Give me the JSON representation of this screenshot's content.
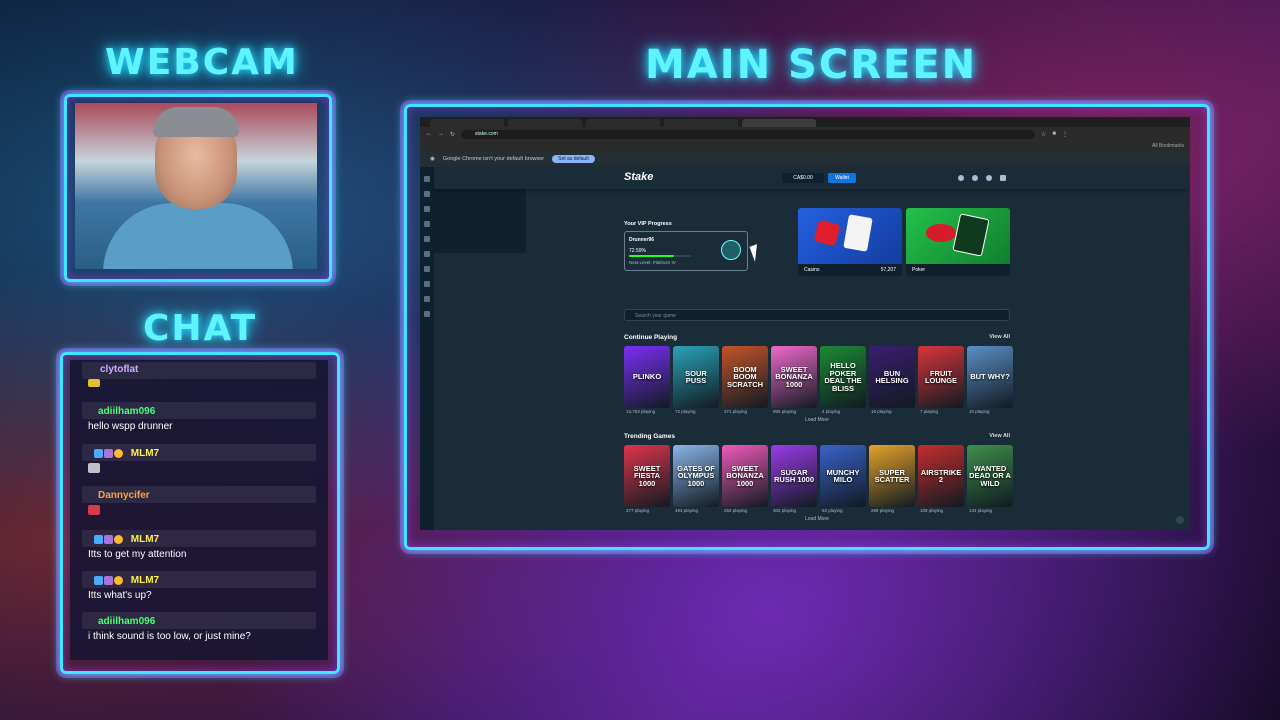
{
  "overlay": {
    "webcam_title": "WEBCAM",
    "main_title": "MAIN SCREEN",
    "chat_title": "CHAT"
  },
  "chat": {
    "messages": [
      {
        "user": "clytoflat",
        "text": "",
        "color": "#c6a7ff"
      },
      {
        "user": "adiilham096",
        "text": "hello wspp drunner",
        "color": "#39ff6a"
      },
      {
        "user": "MLM7",
        "text": "",
        "color": "#fff03a"
      },
      {
        "user": "Dannycifer",
        "text": "",
        "color": "#ff9a2b"
      },
      {
        "user": "MLM7",
        "text": "Itts to get my attention",
        "color": "#fff03a"
      },
      {
        "user": "MLM7",
        "text": "Itts what's up?",
        "color": "#fff03a"
      },
      {
        "user": "adiilham096",
        "text": "i think sound is too low, or just mine?",
        "color": "#39ff6a"
      }
    ]
  },
  "browser": {
    "url": "stake.com",
    "bookmarks_label": "All Bookmarks",
    "default_browser_notice": "Google Chrome isn't your default browser",
    "set_default_label": "Set as default"
  },
  "stake": {
    "logo": "Stake",
    "balance": "CA$0.00",
    "wallet_label": "Wallet",
    "vip": {
      "title": "Your VIP Progress",
      "user": "Drunner96",
      "progress_text": "72.59%",
      "progress_fraction": 0.7259,
      "next_level": "Next Level: Platinum IV"
    },
    "promos": [
      {
        "label": "Casino",
        "count": "57,207",
        "color": "#1e5fd6"
      },
      {
        "label": "Poker",
        "count": "",
        "color": "#1ea040"
      }
    ],
    "search_placeholder": "Search your game",
    "continue_title": "Continue Playing",
    "trending_title": "Trending Games",
    "view_all": "View All",
    "load_more": "Load More",
    "continue_games": [
      {
        "name": "PLINKO",
        "playing": "13,753 playing",
        "color": "#7b2ff7"
      },
      {
        "name": "SOUR PUSS",
        "playing": "72 playing",
        "color": "#2aa3b8"
      },
      {
        "name": "BOOM BOOM SCRATCH",
        "playing": "371 playing",
        "color": "#c4542a"
      },
      {
        "name": "SWEET BONANZA 1000",
        "playing": "955 playing",
        "color": "#f06acb"
      },
      {
        "name": "HELLO POKER DEAL THE BLISS",
        "playing": "4 playing",
        "color": "#1c8a33"
      },
      {
        "name": "BUN HELSING",
        "playing": "16 playing",
        "color": "#3a1e70"
      },
      {
        "name": "FRUIT LOUNGE",
        "playing": "7 playing",
        "color": "#d9353a"
      },
      {
        "name": "BUT WHY?",
        "playing": "10 playing",
        "color": "#5b8fc7"
      }
    ],
    "trending_games": [
      {
        "name": "SWEET FIESTA 1000",
        "playing": "277 playing",
        "color": "#e0344d"
      },
      {
        "name": "GATES OF OLYMPUS 1000",
        "playing": "493 playing",
        "color": "#8bb5e8"
      },
      {
        "name": "SWEET BONANZA 1000",
        "playing": "253 playing",
        "color": "#f05ab8"
      },
      {
        "name": "SUGAR RUSH 1000",
        "playing": "302 playing",
        "color": "#9b3be8"
      },
      {
        "name": "MUNCHY MILO",
        "playing": "52 playing",
        "color": "#3a63c9"
      },
      {
        "name": "SUPER SCATTER",
        "playing": "289 playing",
        "color": "#e6a32a"
      },
      {
        "name": "AIRSTRIKE 2",
        "playing": "108 playing",
        "color": "#c62d2d"
      },
      {
        "name": "WANTED DEAD OR A WILD",
        "playing": "134 playing",
        "color": "#3f8f4a"
      }
    ]
  }
}
